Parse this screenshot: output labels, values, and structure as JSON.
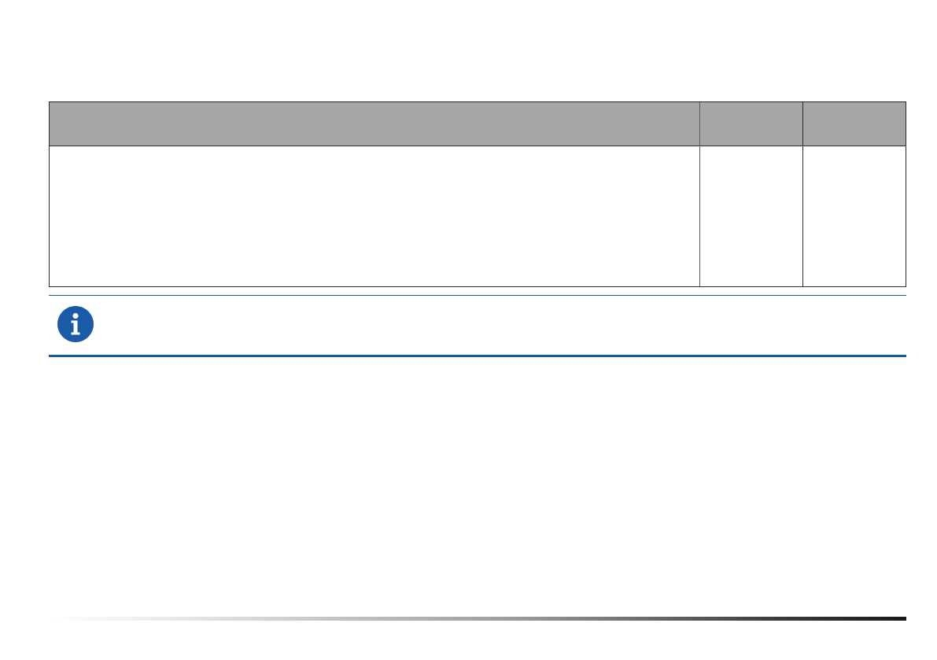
{
  "table": {
    "header": {
      "col1": "",
      "col2": "",
      "col3": ""
    },
    "row": {
      "col1": "",
      "col2": "",
      "col3": ""
    }
  },
  "note": {
    "icon": "info-icon",
    "text": ""
  },
  "colors": {
    "header_bg": "#a7a5a6",
    "note_rule": "#1a5aa6",
    "icon_fill": "#1a5aa6"
  }
}
